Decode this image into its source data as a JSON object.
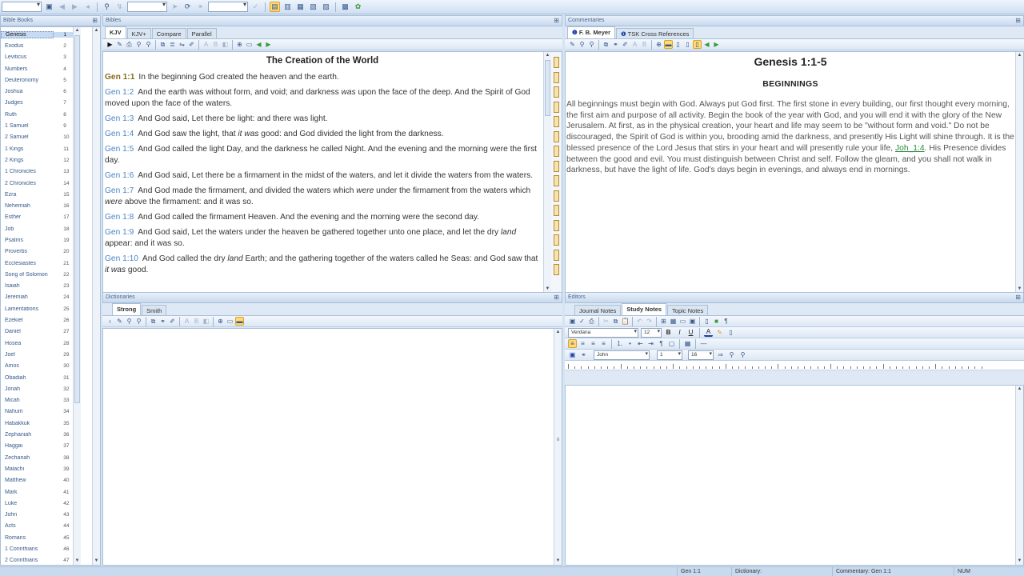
{
  "main_toolbar": {
    "search_placeholder": "",
    "icons": [
      "dropdown-combo",
      "save-icon",
      "back-icon",
      "forward-icon",
      "find-icon",
      "history-icon",
      "zoom-combo",
      "layout-1-icon",
      "layout-2-icon",
      "layout-3-icon",
      "layout-4-icon",
      "layout-5-icon",
      "grid-icon",
      "palette-icon"
    ]
  },
  "panes": {
    "bible_books": "Bible Books",
    "bibles": "Bibles",
    "commentaries": "Commentaries",
    "dictionaries": "Dictionaries",
    "editors": "Editors"
  },
  "books": [
    {
      "name": "Genesis",
      "num": "1"
    },
    {
      "name": "Exodus",
      "num": "2"
    },
    {
      "name": "Leviticus",
      "num": "3"
    },
    {
      "name": "Numbers",
      "num": "4"
    },
    {
      "name": "Deuteronomy",
      "num": "5"
    },
    {
      "name": "Joshua",
      "num": "6"
    },
    {
      "name": "Judges",
      "num": "7"
    },
    {
      "name": "Ruth",
      "num": "8"
    },
    {
      "name": "1 Samuel",
      "num": "9"
    },
    {
      "name": "2 Samuel",
      "num": "10"
    },
    {
      "name": "1 Kings",
      "num": "11"
    },
    {
      "name": "2 Kings",
      "num": "12"
    },
    {
      "name": "1 Chronicles",
      "num": "13"
    },
    {
      "name": "2 Chronicles",
      "num": "14"
    },
    {
      "name": "Ezra",
      "num": "15"
    },
    {
      "name": "Nehemiah",
      "num": "16"
    },
    {
      "name": "Esther",
      "num": "17"
    },
    {
      "name": "Job",
      "num": "18"
    },
    {
      "name": "Psalms",
      "num": "19"
    },
    {
      "name": "Proverbs",
      "num": "20"
    },
    {
      "name": "Ecclesiastes",
      "num": "21"
    },
    {
      "name": "Song of Solomon",
      "num": "22"
    },
    {
      "name": "Isaiah",
      "num": "23"
    },
    {
      "name": "Jeremiah",
      "num": "24"
    },
    {
      "name": "Lamentations",
      "num": "25"
    },
    {
      "name": "Ezekiel",
      "num": "26"
    },
    {
      "name": "Daniel",
      "num": "27"
    },
    {
      "name": "Hosea",
      "num": "28"
    },
    {
      "name": "Joel",
      "num": "29"
    },
    {
      "name": "Amos",
      "num": "30"
    },
    {
      "name": "Obadiah",
      "num": "31"
    },
    {
      "name": "Jonah",
      "num": "32"
    },
    {
      "name": "Micah",
      "num": "33"
    },
    {
      "name": "Nahum",
      "num": "34"
    },
    {
      "name": "Habakkuk",
      "num": "35"
    },
    {
      "name": "Zephaniah",
      "num": "36"
    },
    {
      "name": "Haggai",
      "num": "37"
    },
    {
      "name": "Zechariah",
      "num": "38"
    },
    {
      "name": "Malachi",
      "num": "39"
    },
    {
      "name": "Matthew",
      "num": "40"
    },
    {
      "name": "Mark",
      "num": "41"
    },
    {
      "name": "Luke",
      "num": "42"
    },
    {
      "name": "John",
      "num": "43"
    },
    {
      "name": "Acts",
      "num": "44"
    },
    {
      "name": "Romans",
      "num": "45"
    },
    {
      "name": "1 Corinthians",
      "num": "46"
    },
    {
      "name": "2 Corinthians",
      "num": "47"
    }
  ],
  "bible_tabs": [
    "KJV",
    "KJV+",
    "Compare",
    "Parallel"
  ],
  "bible": {
    "section_title": "The Creation of the World",
    "verses": [
      {
        "ref": "Gen 1:1",
        "parts": [
          {
            "t": "In the beginning God created the heaven and the earth."
          }
        ]
      },
      {
        "ref": "Gen 1:2",
        "parts": [
          {
            "t": "And the earth was without form, and void; and darkness "
          },
          {
            "t": "was",
            "i": true
          },
          {
            "t": " upon the face of the deep. And the Spirit of God moved upon the face of the waters."
          }
        ]
      },
      {
        "ref": "Gen 1:3",
        "parts": [
          {
            "t": "And God said, Let there be light: and there was light."
          }
        ]
      },
      {
        "ref": "Gen 1:4",
        "parts": [
          {
            "t": "And God saw the light, that "
          },
          {
            "t": "it was",
            "i": true
          },
          {
            "t": " good: and God divided the light from the darkness."
          }
        ]
      },
      {
        "ref": "Gen 1:5",
        "parts": [
          {
            "t": "And God called the light Day, and the darkness he called Night. And the evening and the morning were the first day."
          }
        ]
      },
      {
        "ref": "Gen 1:6",
        "parts": [
          {
            "t": "And God said, Let there be a firmament in the midst of the waters, and let it divide the waters from the waters."
          }
        ]
      },
      {
        "ref": "Gen 1:7",
        "parts": [
          {
            "t": "And God made the firmament, and divided the waters which "
          },
          {
            "t": "were",
            "i": true
          },
          {
            "t": " under the firmament from the waters which "
          },
          {
            "t": "were",
            "i": true
          },
          {
            "t": " above the firmament: and it was so."
          }
        ]
      },
      {
        "ref": "Gen 1:8",
        "parts": [
          {
            "t": "And God called the firmament Heaven. And the evening and the morning were the second day."
          }
        ]
      },
      {
        "ref": "Gen 1:9",
        "parts": [
          {
            "t": "And God said, Let the waters under the heaven be gathered together unto one place, and let the dry "
          },
          {
            "t": "land",
            "i": true
          },
          {
            "t": " appear: and it was so."
          }
        ]
      },
      {
        "ref": "Gen 1:10",
        "parts": [
          {
            "t": "And God called the dry "
          },
          {
            "t": "land",
            "i": true
          },
          {
            "t": " Earth; and the gathering together of the waters called he Seas: and God saw that "
          },
          {
            "t": "it was",
            "i": true
          },
          {
            "t": " good."
          }
        ]
      }
    ]
  },
  "commentary_tabs": [
    "F. B. Meyer",
    "TSK Cross References"
  ],
  "commentary": {
    "title": "Genesis 1:1-5",
    "subtitle": "BEGINNINGS",
    "body_before_link": "All beginnings must begin with God. Always put God first. The first stone in every building, our first thought every morning, the first aim and purpose of all activity. Begin the book of the year with God, and you will end it with the glory of the New Jerusalem. At first, as in the physical creation, your heart and life may seem to be \"without form and void.\" Do not be discouraged, the Spirit of God is within you, brooding amid the darkness, and presently His Light will shine through. It is the blessed presence of the Lord Jesus that stirs in your heart and will presently rule your life, ",
    "link": "Joh_1:4",
    "body_after_link": ". His Presence divides between the good and evil. You must distinguish between Christ and self. Follow the gleam, and you shall not walk in darkness, but have the light of life. God's days begin in evenings, and always end in mornings."
  },
  "dictionary_tabs": [
    "Strong",
    "Smith"
  ],
  "editor_tabs": [
    "Journal Notes",
    "Study Notes",
    "Topic Notes"
  ],
  "editor": {
    "font_name": "Verdana",
    "font_size": "12",
    "book": "John",
    "chapter": "1",
    "verse": "16"
  },
  "status": {
    "verse": "Gen 1:1",
    "dictionary": "Dictionary:",
    "commentary": "Commentary: Gen 1:1",
    "num": "NUM"
  }
}
